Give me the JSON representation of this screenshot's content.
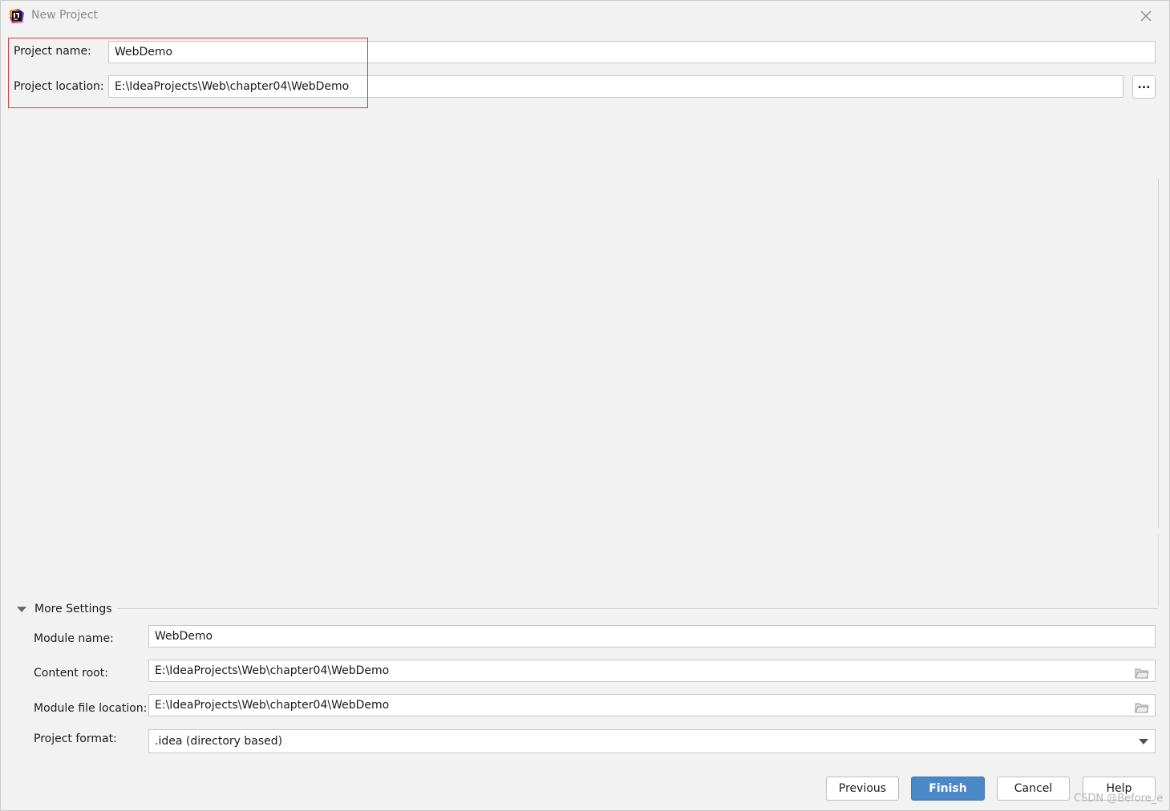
{
  "window": {
    "title": "New Project"
  },
  "project": {
    "name_label": "Project name:",
    "name_value": "WebDemo",
    "location_label": "Project location:",
    "location_value": "E:\\IdeaProjects\\Web\\chapter04\\WebDemo",
    "browse_label": "..."
  },
  "more_settings": {
    "title": "More Settings",
    "module_name_label": "Module name:",
    "module_name_value": "WebDemo",
    "content_root_label": "Content root:",
    "content_root_value": "E:\\IdeaProjects\\Web\\chapter04\\WebDemo",
    "module_file_label": "Module file location:",
    "module_file_value": "E:\\IdeaProjects\\Web\\chapter04\\WebDemo",
    "format_label": "Project format:",
    "format_value": ".idea (directory based)"
  },
  "buttons": {
    "previous": "Previous",
    "finish": "Finish",
    "cancel": "Cancel",
    "help": "Help"
  },
  "watermark": "CSDN @Before_e",
  "colors": {
    "primary": "#4a88c7",
    "highlight": "#d93a3a",
    "background": "#f2f2f2"
  }
}
